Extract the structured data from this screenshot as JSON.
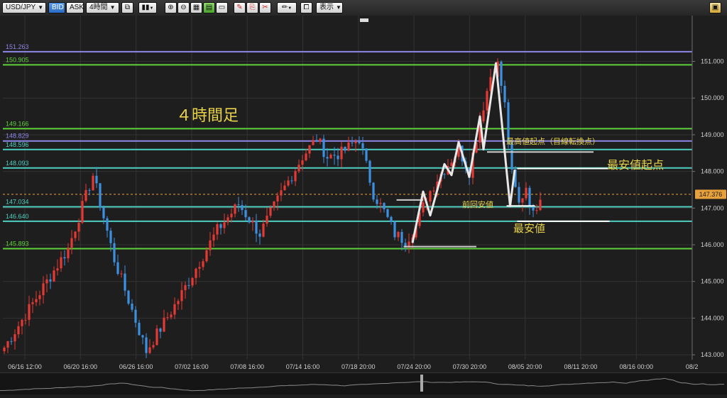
{
  "toolbar": {
    "symbol": "USD/JPY",
    "bid_label": "BID",
    "ask_label": "ASK",
    "timeframe": "4時間",
    "display_label": "表示",
    "icons": [
      "link-icon",
      "candlestick-icon",
      "zoom-in-icon",
      "zoom-out-icon",
      "chart-grid-icon",
      "chart-green-icon",
      "window-icon",
      "draw-red-icon",
      "draw-copy-icon",
      "draw-remove-icon",
      "pencil-icon",
      "copy-icon",
      "settings-icon"
    ]
  },
  "chart_data": {
    "type": "candlestick",
    "title": "４時間足",
    "symbol": "USD/JPY",
    "ylim": [
      142.9,
      152.0
    ],
    "yticks": [
      {
        "value": 143.0,
        "label": "143.000"
      },
      {
        "value": 144.0,
        "label": "144.000"
      },
      {
        "value": 145.0,
        "label": "145.000"
      },
      {
        "value": 146.0,
        "label": "146.000"
      },
      {
        "value": 147.0,
        "label": "147.000"
      },
      {
        "value": 148.0,
        "label": "148.000"
      },
      {
        "value": 149.0,
        "label": "149.000"
      },
      {
        "value": 150.0,
        "label": "150.000"
      },
      {
        "value": 151.0,
        "label": "151.000"
      }
    ],
    "xticks": [
      "06/16 12:00",
      "06/20 16:00",
      "06/26 16:00",
      "07/02 16:00",
      "07/08 16:00",
      "07/14 16:00",
      "07/18 20:00",
      "07/24 20:00",
      "07/30 20:00",
      "08/05 20:00",
      "08/11 20:00",
      "08/16 00:00",
      "08/2"
    ],
    "current_price": {
      "value": 147.376,
      "label": "147.376"
    },
    "horizontal_lines": [
      {
        "value": 151.263,
        "label": "151.263",
        "color": "#8f87e8"
      },
      {
        "value": 150.905,
        "label": "150.905",
        "color": "#5fd13a"
      },
      {
        "value": 149.166,
        "label": "149.166",
        "color": "#5fd13a"
      },
      {
        "value": 148.829,
        "label": "148.829",
        "color": "#8f87e8"
      },
      {
        "value": 148.596,
        "label": "148.596",
        "color": "#4fcfc0"
      },
      {
        "value": 148.093,
        "label": "148.093",
        "color": "#4fcfc0"
      },
      {
        "value": 147.034,
        "label": "147.034",
        "color": "#4fcfc0"
      },
      {
        "value": 146.64,
        "label": "146.640",
        "color": "#4fcfc0"
      },
      {
        "value": 145.893,
        "label": "145.893",
        "color": "#5fd13a"
      }
    ],
    "annotations": [
      {
        "text": "最高値起点（目線転換点）"
      },
      {
        "text": "最安値起点"
      },
      {
        "text": "前回安値"
      },
      {
        "text": "最安値"
      }
    ],
    "key_points": [
      {
        "x": 0,
        "y": 143.2
      },
      {
        "x": 18,
        "y": 145.9
      },
      {
        "x": 25,
        "y": 147.9
      },
      {
        "x": 31,
        "y": 145.6
      },
      {
        "x": 40,
        "y": 143.1
      },
      {
        "x": 49,
        "y": 144.5
      },
      {
        "x": 60,
        "y": 146.4
      },
      {
        "x": 66,
        "y": 147.1
      },
      {
        "x": 72,
        "y": 146.3
      },
      {
        "x": 78,
        "y": 147.4
      },
      {
        "x": 84,
        "y": 148.4
      },
      {
        "x": 88,
        "y": 148.9
      },
      {
        "x": 91,
        "y": 148.4
      },
      {
        "x": 95,
        "y": 148.5
      },
      {
        "x": 100,
        "y": 148.9
      },
      {
        "x": 104,
        "y": 147.4
      },
      {
        "x": 107,
        "y": 146.9
      },
      {
        "x": 110,
        "y": 146.3
      },
      {
        "x": 113,
        "y": 146.1
      },
      {
        "x": 116,
        "y": 146.5
      },
      {
        "x": 119,
        "y": 147.3
      },
      {
        "x": 122,
        "y": 147.8
      },
      {
        "x": 125,
        "y": 148.2
      },
      {
        "x": 128,
        "y": 148.6
      },
      {
        "x": 131,
        "y": 148.0
      },
      {
        "x": 134,
        "y": 149.4
      },
      {
        "x": 137,
        "y": 150.6
      },
      {
        "x": 139,
        "y": 150.9
      },
      {
        "x": 141,
        "y": 149.8
      },
      {
        "x": 143,
        "y": 147.9
      },
      {
        "x": 145,
        "y": 147.1
      },
      {
        "x": 147,
        "y": 147.6
      },
      {
        "x": 149,
        "y": 146.8
      },
      {
        "x": 151,
        "y": 147.38
      }
    ],
    "zigzag": [
      [
        115,
        146.05
      ],
      [
        118,
        147.45
      ],
      [
        120,
        146.8
      ],
      [
        124,
        148.2
      ],
      [
        126,
        147.9
      ],
      [
        128,
        148.8
      ],
      [
        131,
        147.85
      ],
      [
        134,
        149.5
      ],
      [
        135,
        148.6
      ],
      [
        138.5,
        150.95
      ],
      [
        142.5,
        147.05
      ],
      [
        143.8,
        148.05
      ]
    ],
    "segments": [
      {
        "x1": 110.5,
        "x2": 118,
        "y": 147.22,
        "color": "#cfcfcf"
      },
      {
        "x1": 112.5,
        "x2": 133,
        "y": 145.95,
        "color": "#cfcfcf"
      },
      {
        "x1": 136,
        "x2": 166,
        "y": 148.53,
        "color": "#cfcfcf"
      },
      {
        "x1": 144.5,
        "x2": 170,
        "y": 148.08,
        "color": "#ffffff"
      },
      {
        "x1": 141.5,
        "x2": 149.5,
        "y": 147.06,
        "color": "#ffffff"
      },
      {
        "x1": 144.5,
        "x2": 170.5,
        "y": 146.64,
        "color": "#ffffff"
      }
    ]
  }
}
